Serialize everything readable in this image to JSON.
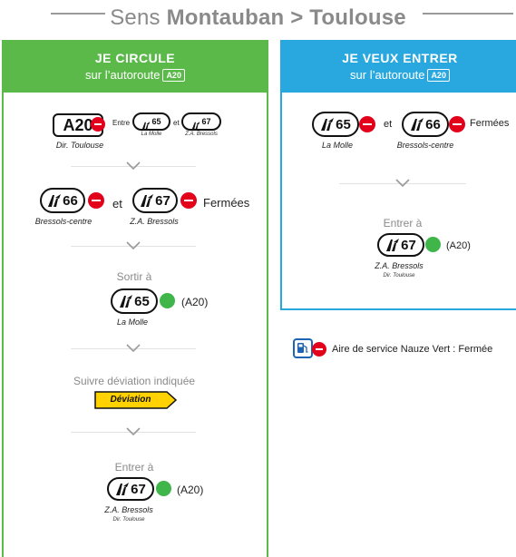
{
  "header": {
    "prefix": "Sens",
    "route": "Montauban > Toulouse"
  },
  "colors": {
    "left_panel": "#5bb94a",
    "right_panel": "#29a8e0",
    "no_entry": "#e3001b",
    "open": "#3fb54a",
    "deviation": "#ffd200"
  },
  "left_panel": {
    "title": "JE CIRCULE",
    "subtitle": "sur l’autoroute",
    "road_tag": "A20",
    "step1": {
      "road": "A20",
      "road_dir": "Dir. Toulouse",
      "between_word": "Entre",
      "and_word": "et",
      "exit_a": "65",
      "exit_a_name": "La Molle",
      "exit_b": "67",
      "exit_b_name": "Z.A. Bressols"
    },
    "step2": {
      "exit_a": "66",
      "exit_a_name": "Bressols-centre",
      "and_word": "et",
      "exit_b": "67",
      "exit_b_name": "Z.A. Bressols",
      "status": "Fermées"
    },
    "step3": {
      "label": "Sortir à",
      "exit": "65",
      "road": "(A20)",
      "exit_name": "La Molle"
    },
    "step4": {
      "label": "Suivre déviation indiquée",
      "sign": "Déviation"
    },
    "step5": {
      "label": "Entrer à",
      "exit": "67",
      "road": "(A20)",
      "exit_name": "Z.A. Bressols",
      "direction": "Dir. Toulouse"
    }
  },
  "right_panel": {
    "title": "JE VEUX ENTRER",
    "subtitle": "sur l’autoroute",
    "road_tag": "A20",
    "step1": {
      "exit_a": "65",
      "exit_a_name": "La Molle",
      "and_word": "et",
      "exit_b": "66",
      "exit_b_name": "Bressols-centre",
      "status": "Fermées"
    },
    "step2": {
      "label": "Entrer à",
      "exit": "67",
      "road": "(A20)",
      "exit_name": "Z.A. Bressols",
      "direction": "Dir. Toulouse"
    }
  },
  "service_area": {
    "text": "Aire de service Nauze Vert : Fermée"
  }
}
